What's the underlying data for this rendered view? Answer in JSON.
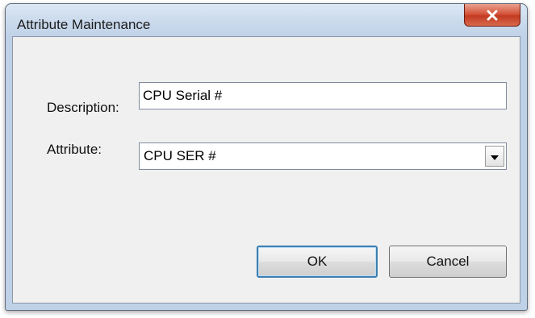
{
  "window": {
    "title": "Attribute Maintenance"
  },
  "form": {
    "description_label": "Description:",
    "description_value": "CPU Serial #",
    "attribute_label": "Attribute:",
    "attribute_value": "CPU SER #"
  },
  "buttons": {
    "ok_label": "OK",
    "cancel_label": "Cancel"
  },
  "icons": {
    "close": "close-icon",
    "dropdown": "chevron-down-icon"
  },
  "colors": {
    "close_button": "#c23b22",
    "default_button_border": "#3c7fb1",
    "client_background": "#f0f0f0"
  }
}
